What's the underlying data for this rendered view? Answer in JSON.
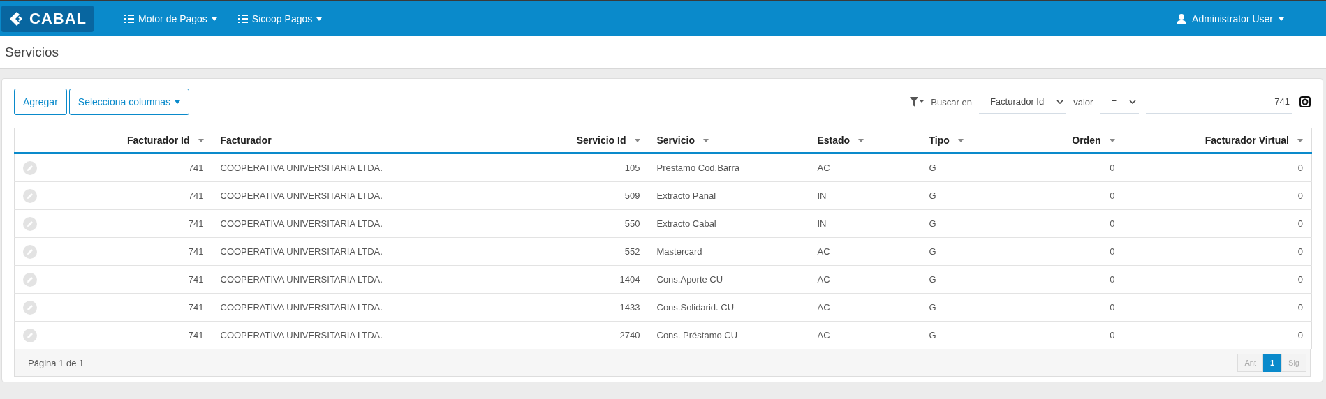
{
  "navbar": {
    "brand": "CABAL",
    "menus": [
      {
        "label": "Motor de Pagos"
      },
      {
        "label": "Sicoop Pagos"
      }
    ],
    "user": "Administrator User"
  },
  "page_title": "Servicios",
  "toolbar": {
    "buttons": [
      {
        "label": "Agregar",
        "dropdown": false
      },
      {
        "label": "Selecciona columnas",
        "dropdown": true
      }
    ],
    "filter": {
      "search_label": "Buscar en",
      "field": "Facturador Id",
      "value_label": "valor",
      "operator": "=",
      "value": "741"
    }
  },
  "table": {
    "columns": [
      {
        "label": "Facturador Id",
        "kind": "number",
        "sortable": true
      },
      {
        "label": "Facturador",
        "kind": "text",
        "sortable": false
      },
      {
        "label": "Servicio Id",
        "kind": "number",
        "sortable": true
      },
      {
        "label": "Servicio",
        "kind": "text",
        "sortable": true
      },
      {
        "label": "Estado",
        "kind": "text",
        "sortable": true
      },
      {
        "label": "Tipo",
        "kind": "text",
        "sortable": true
      },
      {
        "label": "Orden",
        "kind": "number",
        "sortable": true
      },
      {
        "label": "Facturador Virtual",
        "kind": "number",
        "sortable": true
      }
    ],
    "rows": [
      [
        "741",
        "COOPERATIVA UNIVERSITARIA LTDA.",
        "105",
        "Prestamo Cod.Barra",
        "AC",
        "G",
        "0",
        "0"
      ],
      [
        "741",
        "COOPERATIVA UNIVERSITARIA LTDA.",
        "509",
        "Extracto Panal",
        "IN",
        "G",
        "0",
        "0"
      ],
      [
        "741",
        "COOPERATIVA UNIVERSITARIA LTDA.",
        "550",
        "Extracto Cabal",
        "IN",
        "G",
        "0",
        "0"
      ],
      [
        "741",
        "COOPERATIVA UNIVERSITARIA LTDA.",
        "552",
        "Mastercard",
        "AC",
        "G",
        "0",
        "0"
      ],
      [
        "741",
        "COOPERATIVA UNIVERSITARIA LTDA.",
        "1404",
        "Cons.Aporte CU",
        "AC",
        "G",
        "0",
        "0"
      ],
      [
        "741",
        "COOPERATIVA UNIVERSITARIA LTDA.",
        "1433",
        "Cons.Solidarid. CU",
        "AC",
        "G",
        "0",
        "0"
      ],
      [
        "741",
        "COOPERATIVA UNIVERSITARIA LTDA.",
        "2740",
        "Cons. Préstamo CU",
        "AC",
        "G",
        "0",
        "0"
      ]
    ]
  },
  "pagination": {
    "info": "Página 1 de 1",
    "pages": [
      {
        "label": "Ant",
        "selected": false,
        "disabled": true
      },
      {
        "label": "1",
        "selected": true,
        "disabled": false
      },
      {
        "label": "Sig",
        "selected": false,
        "disabled": true
      }
    ]
  }
}
